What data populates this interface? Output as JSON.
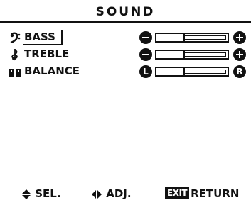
{
  "title": "SOUND",
  "items": [
    {
      "label": "BASS",
      "icon": "bass-clef-icon",
      "selected": true,
      "level": 0.4,
      "left_symbol": "minus",
      "right_symbol": "plus"
    },
    {
      "label": "TREBLE",
      "icon": "treble-clef-icon",
      "selected": false,
      "level": 0.4,
      "left_symbol": "minus",
      "right_symbol": "plus"
    },
    {
      "label": "BALANCE",
      "icon": "speakers-icon",
      "selected": false,
      "level": 0.4,
      "left_symbol": "L",
      "right_symbol": "R"
    }
  ],
  "footer": {
    "select_label": "SEL.",
    "adjust_label": "ADJ.",
    "exit_badge": "EXIT",
    "return_label": "RETURN"
  },
  "colors": {
    "background": "#ffffff",
    "foreground": "#111111"
  }
}
